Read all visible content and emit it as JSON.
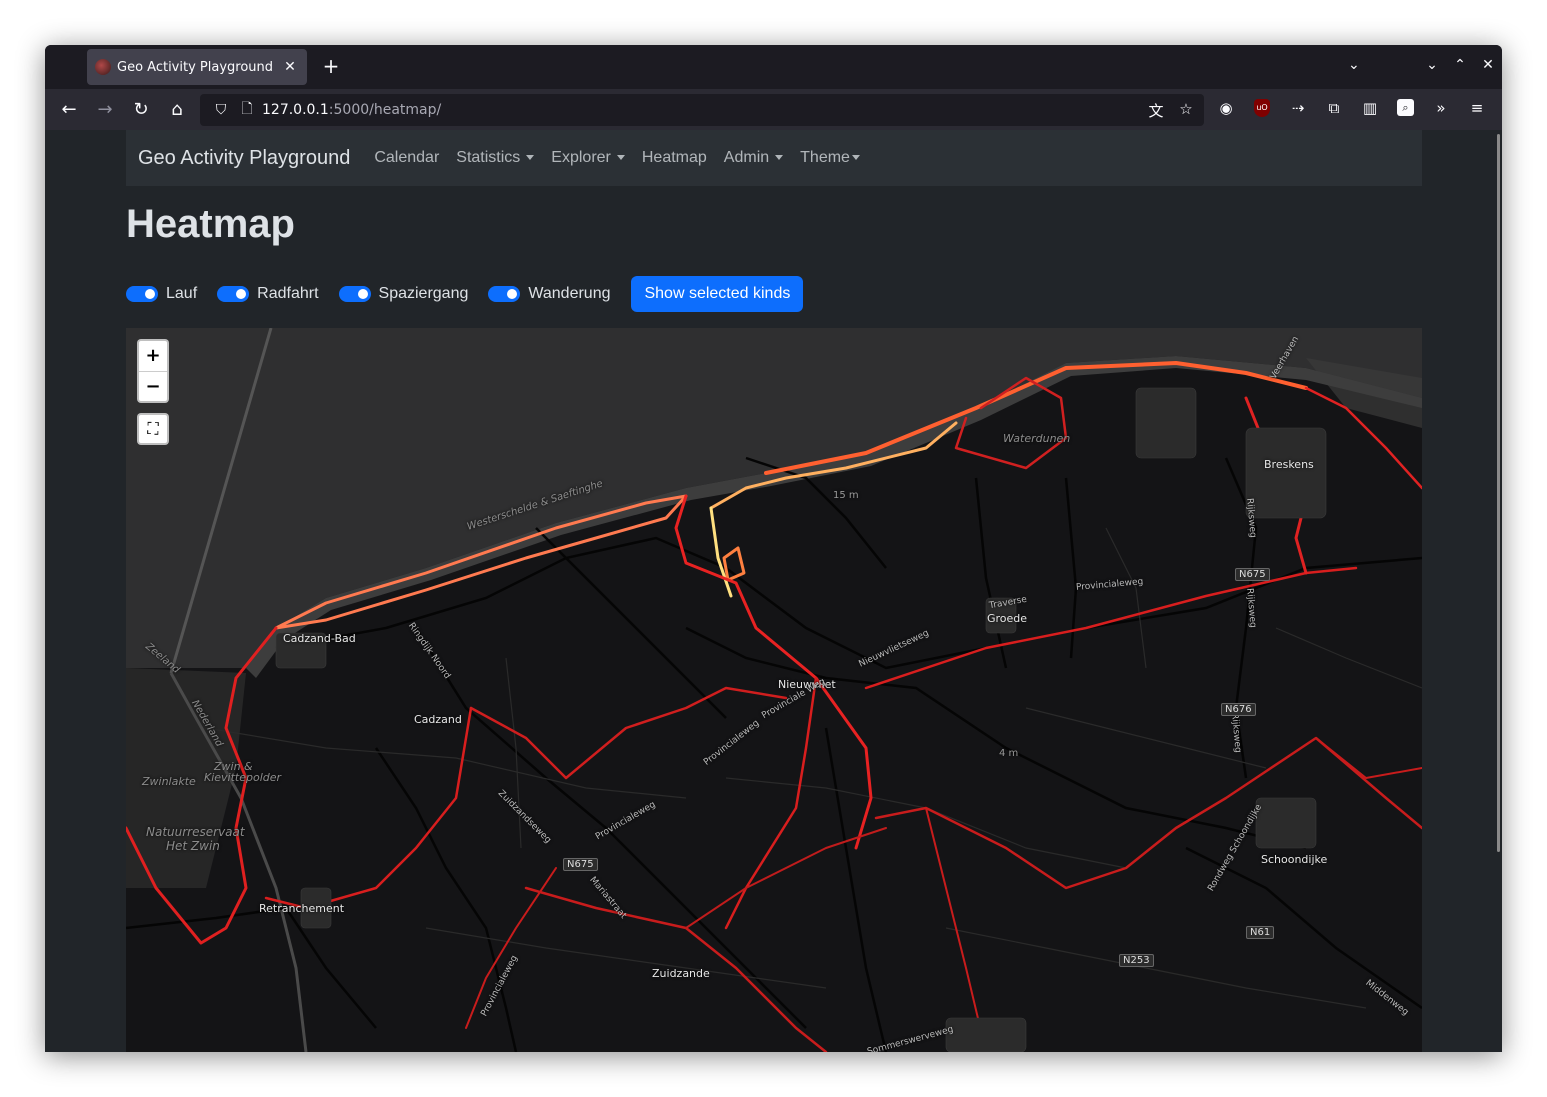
{
  "browser": {
    "tab_title": "Geo Activity Playground",
    "new_tab_label": "+",
    "url_host": "127.0.0.1",
    "url_path": ":5000/heatmap/"
  },
  "site": {
    "brand": "Geo Activity Playground",
    "nav": [
      {
        "label": "Calendar",
        "dropdown": false
      },
      {
        "label": "Statistics",
        "dropdown": true
      },
      {
        "label": "Explorer",
        "dropdown": true
      },
      {
        "label": "Heatmap",
        "dropdown": false
      },
      {
        "label": "Admin",
        "dropdown": true
      },
      {
        "label": "Theme",
        "dropdown": true
      }
    ]
  },
  "main": {
    "title": "Heatmap",
    "kinds": [
      {
        "label": "Lauf",
        "checked": true
      },
      {
        "label": "Radfahrt",
        "checked": true
      },
      {
        "label": "Spaziergang",
        "checked": true
      },
      {
        "label": "Wanderung",
        "checked": true
      }
    ],
    "show_button": "Show selected kinds"
  },
  "map": {
    "zoom_in": "+",
    "zoom_out": "−",
    "fullscreen_icon": "⛶",
    "places": {
      "cadzand_bad": "Cadzand-Bad",
      "cadzand": "Cadzand",
      "retranchement": "Retranchement",
      "zuidzande": "Zuidzande",
      "nieuwvliet": "Nieuwvliet",
      "groede": "Groede",
      "breskens": "Breskens",
      "schoondijke": "Schoondijke",
      "waterdunen": "Waterdunen",
      "zwinlakte": "Zwinlakte",
      "zwin": "Zwin &",
      "kievittepolder": "Kievittepolder",
      "natuurreservaat": "Natuurreservaat",
      "het_zwin": "Het Zwin",
      "westerschelde": "Westerschelde & Saeftinghe",
      "zeeland": "Zeeland",
      "nederland": "Nederland",
      "elev_15": "15 m",
      "elev_4": "4 m"
    },
    "shields": {
      "n675_a": "N675",
      "n675_b": "N675",
      "n676": "N676",
      "n61": "N61",
      "n253": "N253"
    },
    "streets": {
      "ringdijk": "Ringdijk Noord",
      "zuidzandseweg": "Zuidzandseweg",
      "provincialeweg_a": "Provincialeweg",
      "provinciale_weg": "Provinciale Weg",
      "provincialeweg_b": "Provincialeweg",
      "provincialeweg_c": "Provincialeweg",
      "nieuwvlietseweg": "Nieuwvlietseweg",
      "traverse": "Traverse",
      "mariastraat": "Mariastraat",
      "provincialeweg_d": "Provincialeweg",
      "rijksweg_a": "Rijksweg",
      "rijksweg_b": "Rijksweg",
      "rijksweg_c": "Rijksweg",
      "rondweg": "Rondweg Schoondijke",
      "middenweg": "Middenweg",
      "veerhaven": "Veerhaven",
      "sommerswerveweg": "Sommerswerveweg"
    }
  },
  "colors": {
    "accent": "#0d6efd",
    "page_bg": "#212529",
    "navbar_bg": "#2b3035",
    "heat_low": "#d81e1e",
    "heat_mid": "#ff6a30",
    "heat_high": "#ffe080"
  }
}
